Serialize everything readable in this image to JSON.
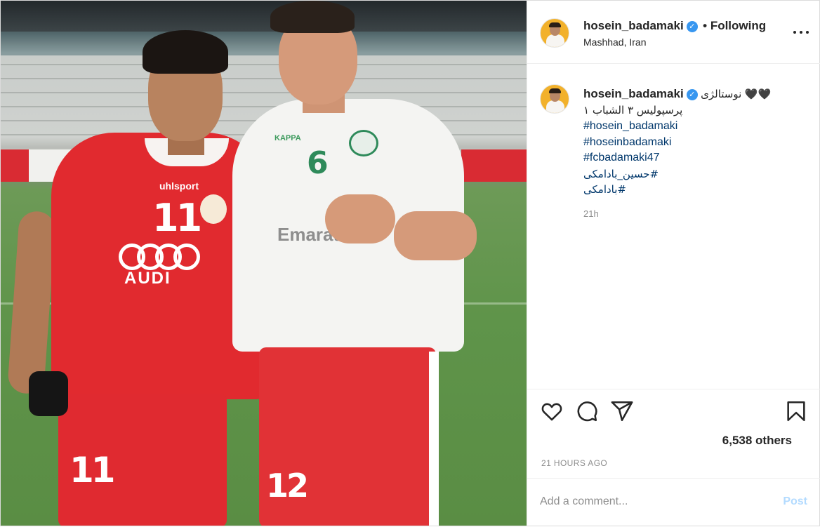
{
  "post": {
    "author": {
      "username": "hosein_badamaki",
      "verified": true,
      "follow_status": "Following",
      "location": "Mashhad, Iran"
    },
    "caption": {
      "line1_text": "نوستالژی",
      "line1_emoji": "🖤🖤",
      "line2": "پرسپولیس ۳ الشباب ۱",
      "hashtags": [
        "#hosein_badamaki",
        "#hoseinbadamaki",
        "#fcbadamaki47",
        "حسین_بادامکی#",
        "بادامکی#"
      ],
      "age": "21h"
    },
    "likes": "6,538 others",
    "timestamp": "21 HOURS AGO",
    "comment": {
      "placeholder": "Add a comment...",
      "post_label": "Post"
    },
    "photo": {
      "left_player": {
        "shirt_number": "11",
        "shorts_number": "11",
        "brand": "uhlsport",
        "sponsor": "AUDI"
      },
      "right_player": {
        "shirt_number": "6",
        "shorts_number": "12",
        "brand": "KAPPA",
        "sponsor": "Emarat"
      }
    },
    "colors": {
      "link": "#00376b",
      "verified": "#3897f0",
      "post_button_disabled": "#b3dbff",
      "secondary_text": "#8e8e8e"
    },
    "icons": [
      "more-options-icon",
      "heart-icon",
      "comment-icon",
      "share-icon",
      "bookmark-icon",
      "verified-badge-icon"
    ]
  }
}
